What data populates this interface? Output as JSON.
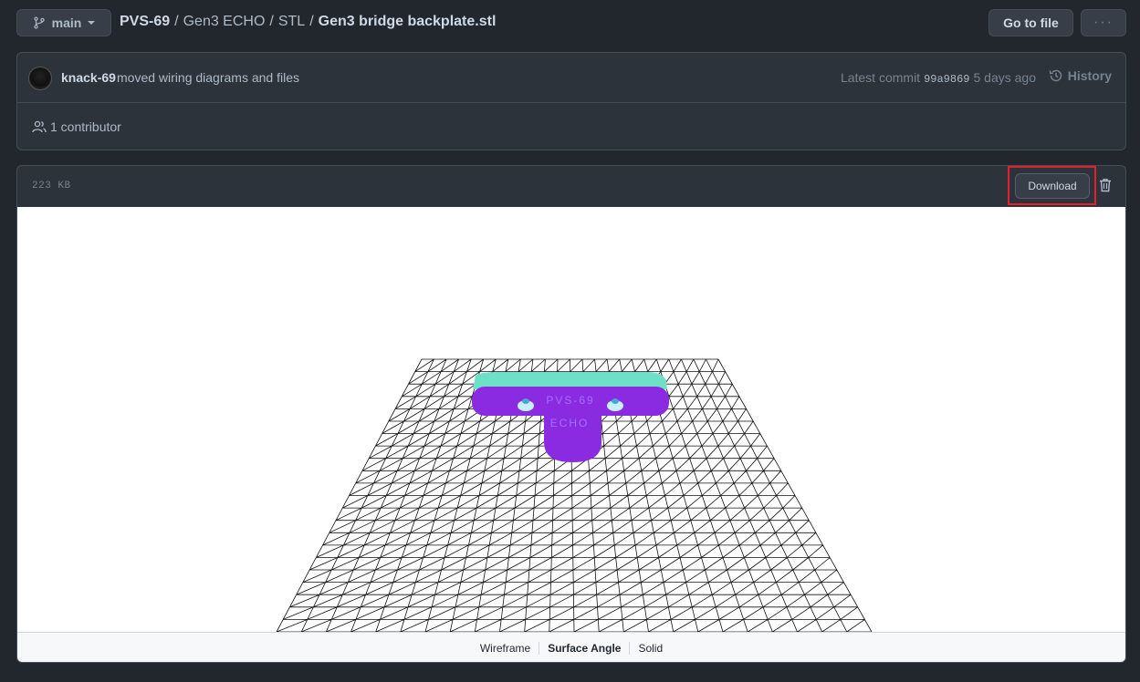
{
  "branch": {
    "label": "main"
  },
  "breadcrumb": {
    "repo": "PVS-69",
    "sep": "/",
    "dirs": [
      "Gen3 ECHO",
      "STL"
    ],
    "file": "Gen3 bridge backplate.stl"
  },
  "header_actions": {
    "goto_label": "Go to file",
    "more_label": "···"
  },
  "commit": {
    "author": "knack-69",
    "message": "moved wiring diagrams and files",
    "latest_label": "Latest commit",
    "sha": "99a9869",
    "time": "5 days ago",
    "history_label": "History",
    "contributors": "1 contributor"
  },
  "file": {
    "size": "223 KB",
    "download_label": "Download"
  },
  "viewer": {
    "model_text_line1": "PVS-69",
    "model_text_line2": "ECHO",
    "colors": {
      "plate": "#8a2be2",
      "top_edge": "#6fe0c8",
      "grid": "#111111"
    },
    "modes": [
      "Wireframe",
      "Surface Angle",
      "Solid"
    ],
    "selected_mode": "Surface Angle"
  }
}
